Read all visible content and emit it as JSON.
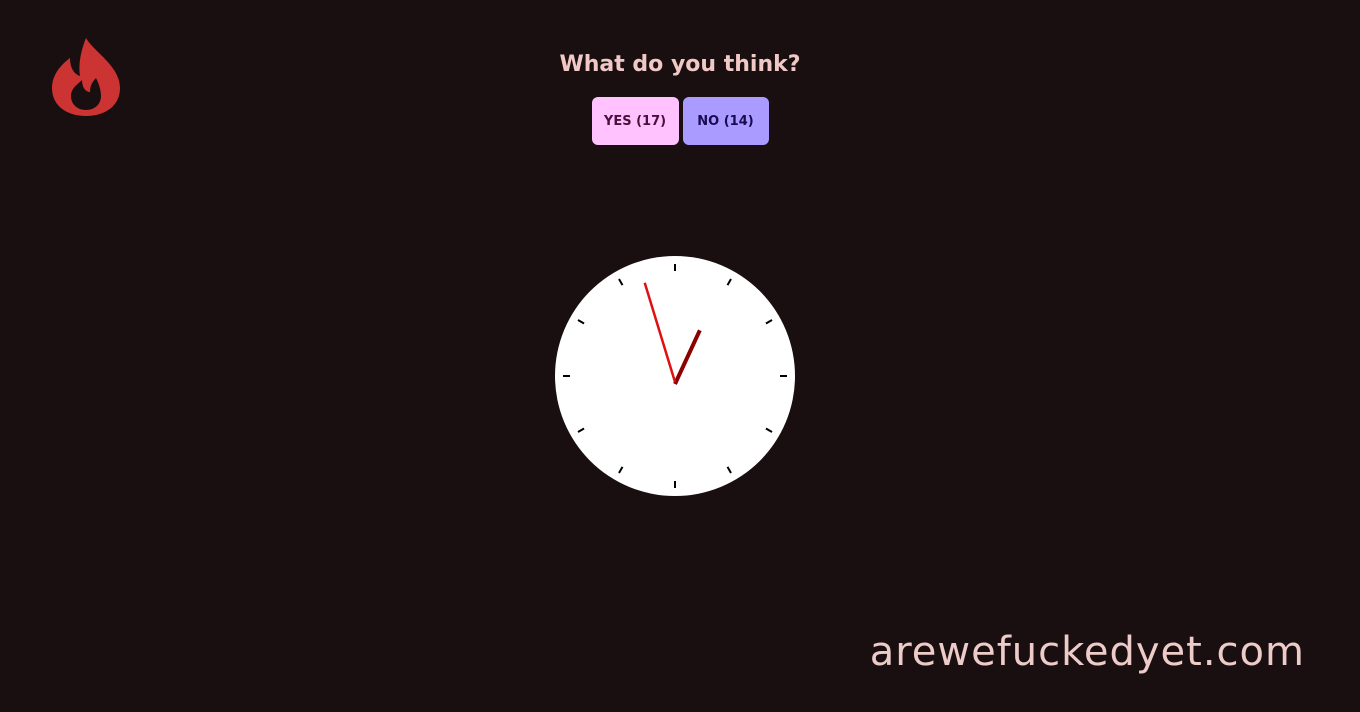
{
  "logo": {
    "icon": "flame-icon",
    "color": "#cc3333"
  },
  "header": {
    "question": "What do you think?"
  },
  "votes": {
    "yes_label": "YES (17)",
    "no_label": "NO (14)",
    "yes_color": "#ffc2ff",
    "no_color": "#a99bff"
  },
  "clock": {
    "hour": 12,
    "minute": 57,
    "hand_color_minute": "#e01010",
    "hand_color_hour": "#8b0000"
  },
  "footer": {
    "domain": "arewefuckedyet.com"
  }
}
